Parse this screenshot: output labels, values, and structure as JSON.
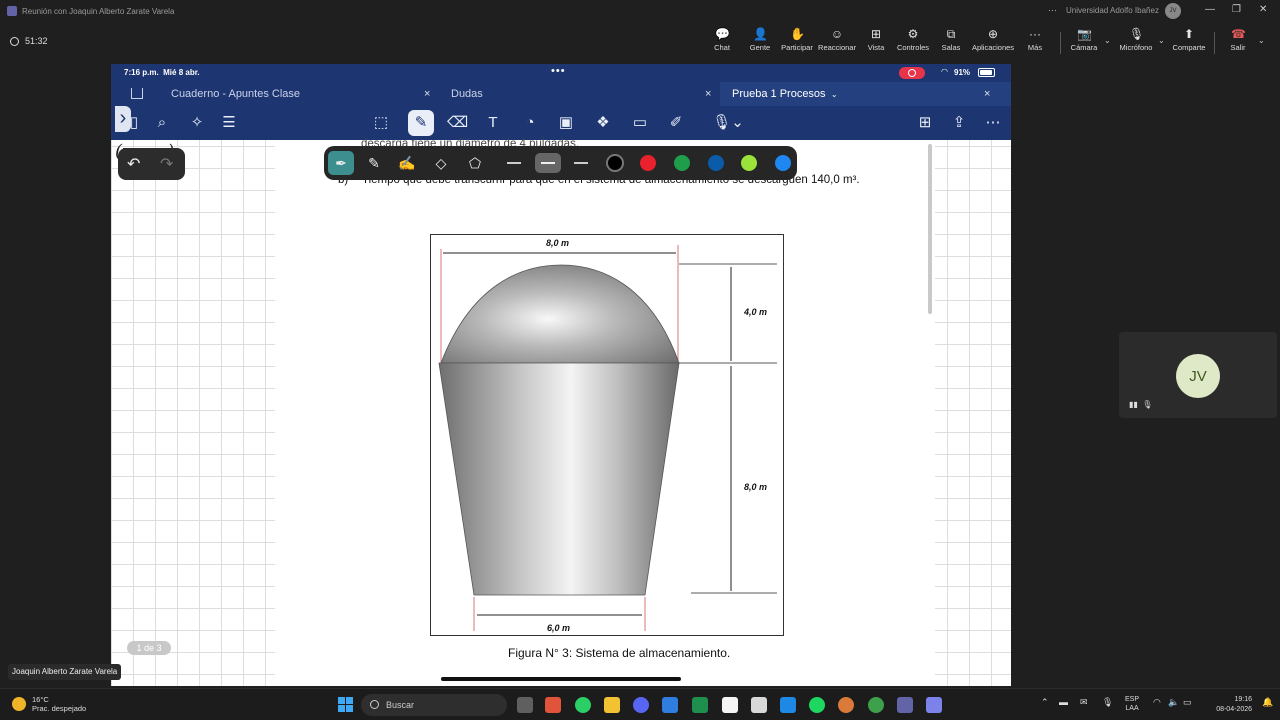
{
  "window": {
    "title": "Reunión con Joaquin Alberto Zarate Varela",
    "org": "Universidad Adolfo Ibañez",
    "org_avatar": "JV",
    "more": "···"
  },
  "meeting": {
    "timer": "51:32",
    "toolbar": [
      {
        "id": "chat",
        "label": "Chat",
        "icon": "chat-icon"
      },
      {
        "id": "people",
        "label": "Gente",
        "icon": "people-icon"
      },
      {
        "id": "raise",
        "label": "Participar",
        "icon": "raise-hand-icon"
      },
      {
        "id": "react",
        "label": "Reaccionar",
        "icon": "smile-icon"
      },
      {
        "id": "view",
        "label": "Vista",
        "icon": "grid-icon"
      },
      {
        "id": "controls",
        "label": "Controles",
        "icon": "shield-gear-icon"
      },
      {
        "id": "rooms",
        "label": "Salas",
        "icon": "rooms-icon"
      },
      {
        "id": "apps",
        "label": "Aplicaciones",
        "icon": "plus-apps-icon"
      },
      {
        "id": "more",
        "label": "Más",
        "icon": "ellipsis-icon"
      }
    ],
    "camera_label": "Cámara",
    "mic_label": "Micrófono",
    "share_label": "Comparte",
    "leave_label": "Salir"
  },
  "ipad": {
    "status_time": "7:16 p.m.",
    "status_date": "Mié 8 abr.",
    "battery": "91%",
    "tabs": [
      {
        "label": "Cuaderno - Apuntes Clase"
      },
      {
        "label": "Dudas"
      },
      {
        "label": "Prueba 1 Procesos",
        "active": true
      }
    ],
    "handwriting": "(x - x₀)",
    "doc_line_top": "descarga tiene un diámetro de 4 pulgadas.",
    "doc_line_b_prefix": "b)",
    "doc_line_b": "Tiempo que debe transcurrir para que en el sistema de almacenamiento se descarguen 140,0 m³.",
    "figure": {
      "dim_top": "8,0 m",
      "dim_dome": "4,0 m",
      "dim_body": "8,0 m",
      "dim_bottom": "6,0 m",
      "caption": "Figura N° 3: Sistema de almacenamiento."
    },
    "page_indicator": "1 de 3",
    "pen_colors": [
      "#000000",
      "#e8212d",
      "#1e9e4b",
      "#0a5ca8",
      "#9be33a",
      "#1e88f0"
    ]
  },
  "participant": {
    "initials": "JV",
    "name": "Joaquin Alberto Zarate Varela"
  },
  "taskbar": {
    "temp": "16°C",
    "weather": "Prac. despejado",
    "search_placeholder": "Buscar",
    "lang_1": "ESP",
    "lang_2": "LAA",
    "time": "19:16",
    "date": "08-04-2026"
  }
}
